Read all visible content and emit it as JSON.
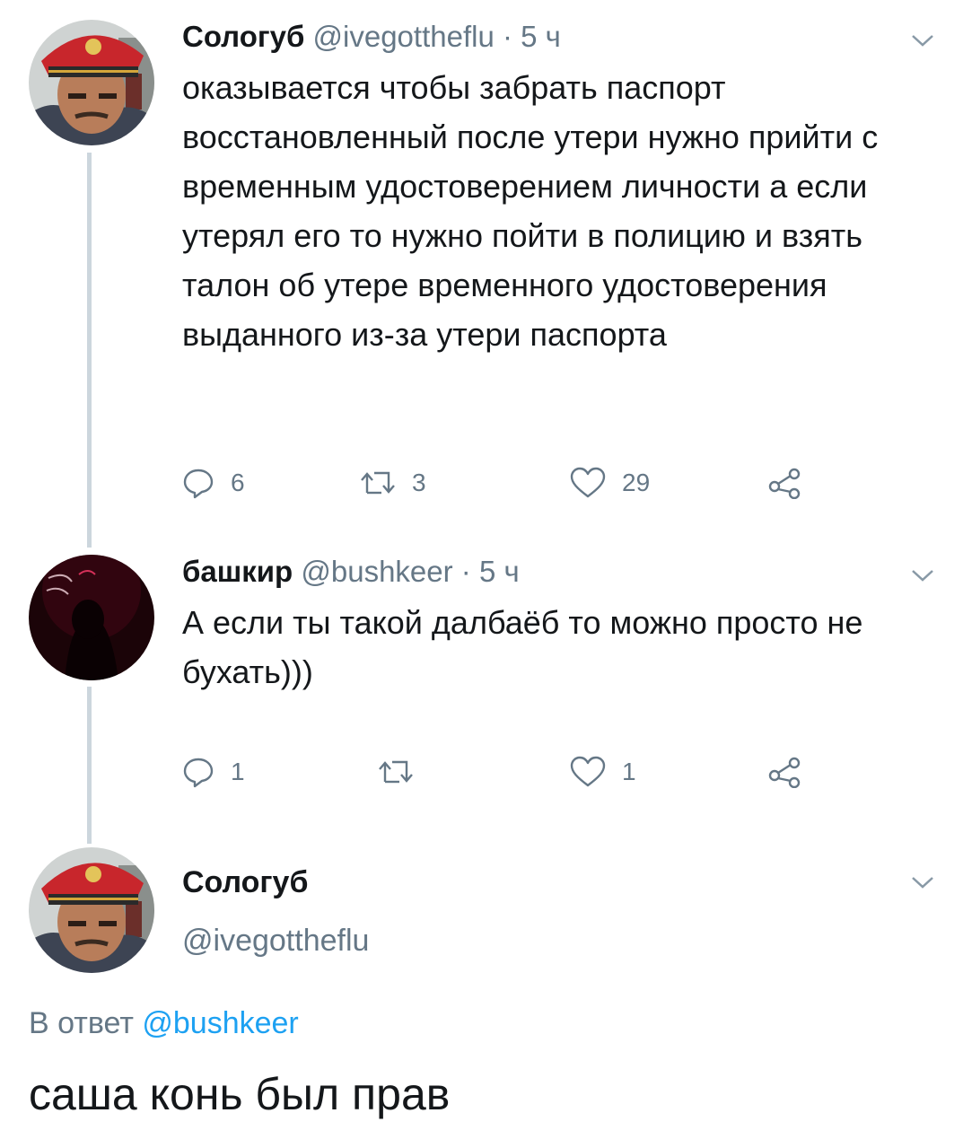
{
  "tweets": [
    {
      "name": "Сологуб",
      "handle": "@ivegottheflu",
      "sep": " · ",
      "time": "5 ч",
      "text": "оказывается чтобы забрать паспорт восстановленный после утери нужно прийти с временным удостоверением личности а если утерял его то нужно пойти в полицию и взять талон об утере временного удостоверения выданного из-за утери паспорта",
      "replies": "6",
      "retweets": "3",
      "likes": "29"
    },
    {
      "name": "башкир",
      "handle": "@bushkeer",
      "sep": " · ",
      "time": "5 ч",
      "text": "А если ты такой далбаёб то можно просто не бухать)))",
      "replies": "1",
      "retweets": "",
      "likes": "1"
    }
  ],
  "focused": {
    "name": "Сологуб",
    "handle": "@ivegottheflu",
    "reply_prefix": "В ответ",
    "reply_to": "@bushkeer",
    "text": "саша конь был прав"
  },
  "colors": {
    "link": "#1da1f2",
    "secondary": "#657786",
    "thread_line": "#ccd6dd",
    "text": "#14171a"
  },
  "icons": [
    "reply-icon",
    "retweet-icon",
    "like-icon",
    "share-icon",
    "chevron-down-icon"
  ]
}
